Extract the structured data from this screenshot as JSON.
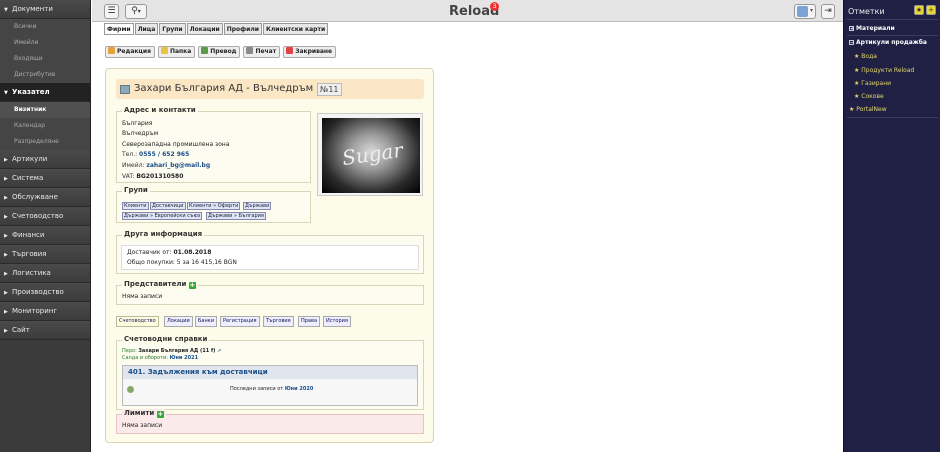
{
  "app": {
    "title": "Reload",
    "notifications": "3"
  },
  "sidebar": {
    "groups": [
      {
        "label": "Документи",
        "open": true,
        "items": [
          "Всички",
          "Имейли",
          "Входящи",
          "Дистрибутив"
        ]
      },
      {
        "label": "Указател",
        "open": true,
        "active": true,
        "items": [
          "Визитник",
          "Календар",
          "Разпределяне"
        ]
      },
      {
        "label": "Артикули"
      },
      {
        "label": "Система"
      },
      {
        "label": "Обслужване"
      },
      {
        "label": "Счетоводство"
      },
      {
        "label": "Финанси"
      },
      {
        "label": "Търговия"
      },
      {
        "label": "Логистика"
      },
      {
        "label": "Производство"
      },
      {
        "label": "Мониторинг"
      },
      {
        "label": "Сайт"
      }
    ]
  },
  "tabs": [
    "Фирми",
    "Лица",
    "Групи",
    "Локации",
    "Профили",
    "Клиентски карти"
  ],
  "toolbar": {
    "edit": "Редакция",
    "folder": "Папка",
    "translate": "Превод",
    "print": "Печат",
    "close": "Закриване"
  },
  "company": {
    "name": "Захари България АД - Вълчедръм",
    "number": "№11"
  },
  "address": {
    "legend": "Адрес и контакти",
    "country": "България",
    "city": "Вълчедръм",
    "zone": "Северозападна промишлена зона",
    "phone_label": "Тел.:",
    "phone": "0555 / 652 965",
    "email_label": "Имейл:",
    "email": "zahari_bg@mail.bg",
    "vat_label": "VAT:",
    "vat": "BG201310580"
  },
  "photo": {
    "text": "Sugar"
  },
  "groups": {
    "legend": "Групи",
    "chips": [
      "Клиенти",
      "Доставчици",
      "Клиенти » Оферти",
      "Държави",
      "Държави » Европейски съюз",
      "Държави » България"
    ]
  },
  "other": {
    "legend": "Друга информация",
    "supplier_label": "Доставчик от:",
    "supplier_date": "01.08.2018",
    "purchases": "Общо покупки: 5 за 16 415,16 BGN"
  },
  "reps": {
    "legend": "Представители",
    "empty": "Няма записи"
  },
  "subtabs": [
    "Счетоводство",
    "Локации",
    "Банки",
    "Регистрация",
    "Търговия",
    "Права",
    "История"
  ],
  "accounting": {
    "legend": "Счетоводни справки",
    "pero_label": "Перо:",
    "pero_value": "Захари България АД (11 f)",
    "balance_label": "Салда и обороти:",
    "balance_value": "Юни 2021",
    "report_title": "401. Задължения към доставчици",
    "last_label": "Последни записи от",
    "last_value": "Юни 2020"
  },
  "limits": {
    "legend": "Лимити",
    "empty": "Няма записи"
  },
  "rightpanel": {
    "title": "Отметки",
    "items": [
      {
        "label": "Материали",
        "head": true
      },
      {
        "label": "Артикули продажба",
        "head": true
      },
      {
        "label": "Вода"
      },
      {
        "label": "Продукти Reload"
      },
      {
        "label": "Газирани"
      },
      {
        "label": "Сокове"
      },
      {
        "label": "PortalNew"
      }
    ]
  },
  "colors": {
    "sidebar": "#3b3b3b",
    "rightpanel": "#1f2044",
    "card": "#fdfbe9",
    "head": "#fbe6c6",
    "link": "#1a4e8a"
  }
}
